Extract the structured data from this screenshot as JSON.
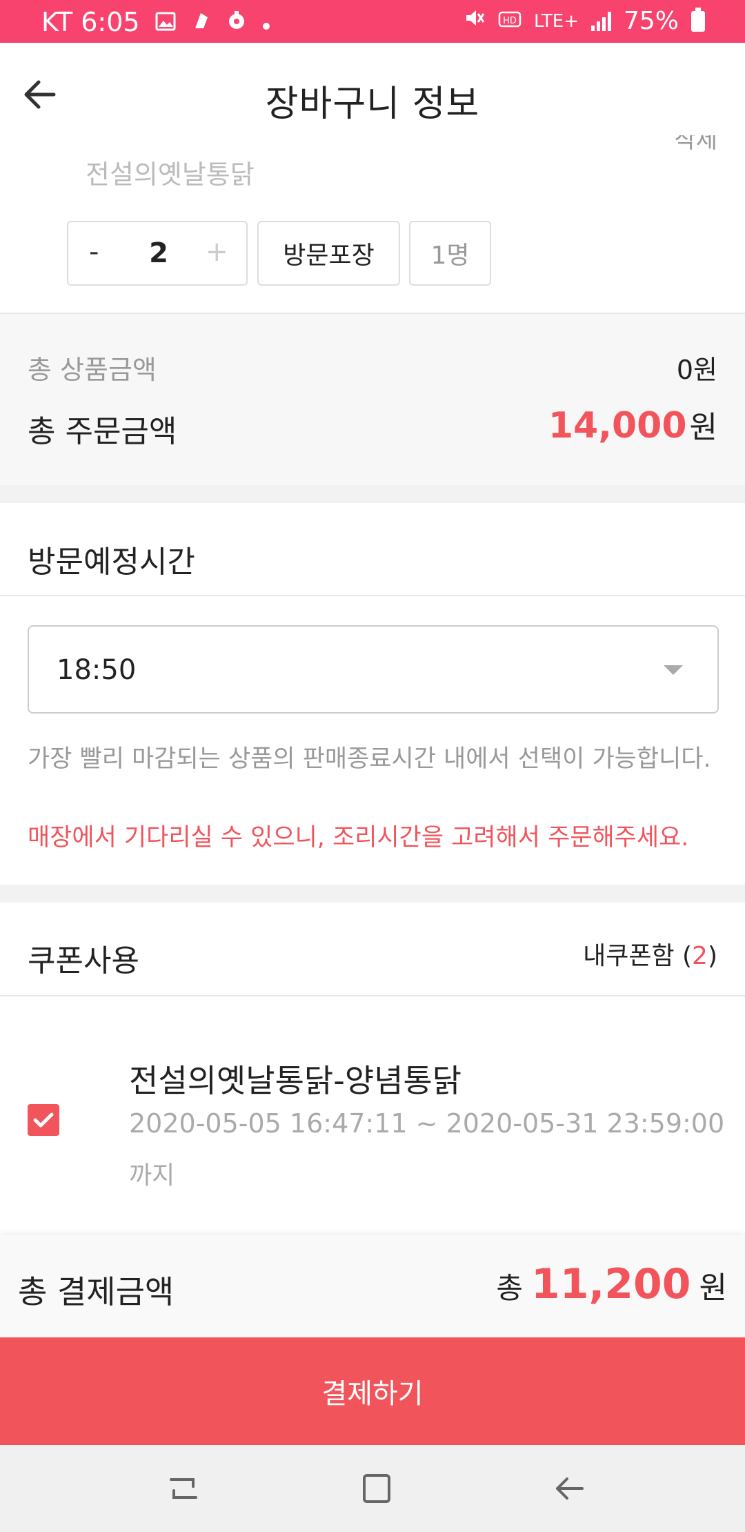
{
  "status_bar": {
    "carrier_time": "KT 6:05",
    "network": "LTE+",
    "battery": "75%",
    "icons": [
      "image-icon",
      "app-icon",
      "location-icon",
      "dot-icon",
      "mute-icon",
      "hd-icon",
      "signal-icon",
      "battery-icon"
    ]
  },
  "header": {
    "title": "장바구니 정보",
    "back_icon": "arrow-left-icon",
    "partial_text": "삭제"
  },
  "item": {
    "store_name": "전설의옛날통닭",
    "minus_label": "-",
    "quantity": "2",
    "plus_label": "+",
    "pack_option": "방문포장",
    "people": "1명"
  },
  "totals": {
    "product_label": "총 상품금액",
    "product_value": "0원",
    "order_label": "총 주문금액",
    "order_amount": "14,000",
    "order_unit": "원"
  },
  "visit_time": {
    "title": "방문예정시간",
    "selected": "18:50",
    "info": "가장 빨리 마감되는 상품의 판매종료시간 내에서 선택이 가능합니다.",
    "warning": "매장에서 기다리실 수 있으니, 조리시간을 고려해서 주문해주세요."
  },
  "coupon": {
    "title": "쿠폰사용",
    "box_label": "내쿠폰함 (",
    "box_count": "2",
    "box_close": ")",
    "item_title": "전설의옛날통닭-양념통닭",
    "item_period": "2020-05-05 16:47:11 ~ 2020-05-31 23:59:00",
    "item_until": "까지",
    "checked": true
  },
  "payment": {
    "label": "총 결제금액",
    "prefix": "총",
    "amount": "11,200",
    "unit": "원",
    "button_label": "결제하기"
  },
  "colors": {
    "status_bar": "#f8436f",
    "accent": "#f2545b"
  }
}
